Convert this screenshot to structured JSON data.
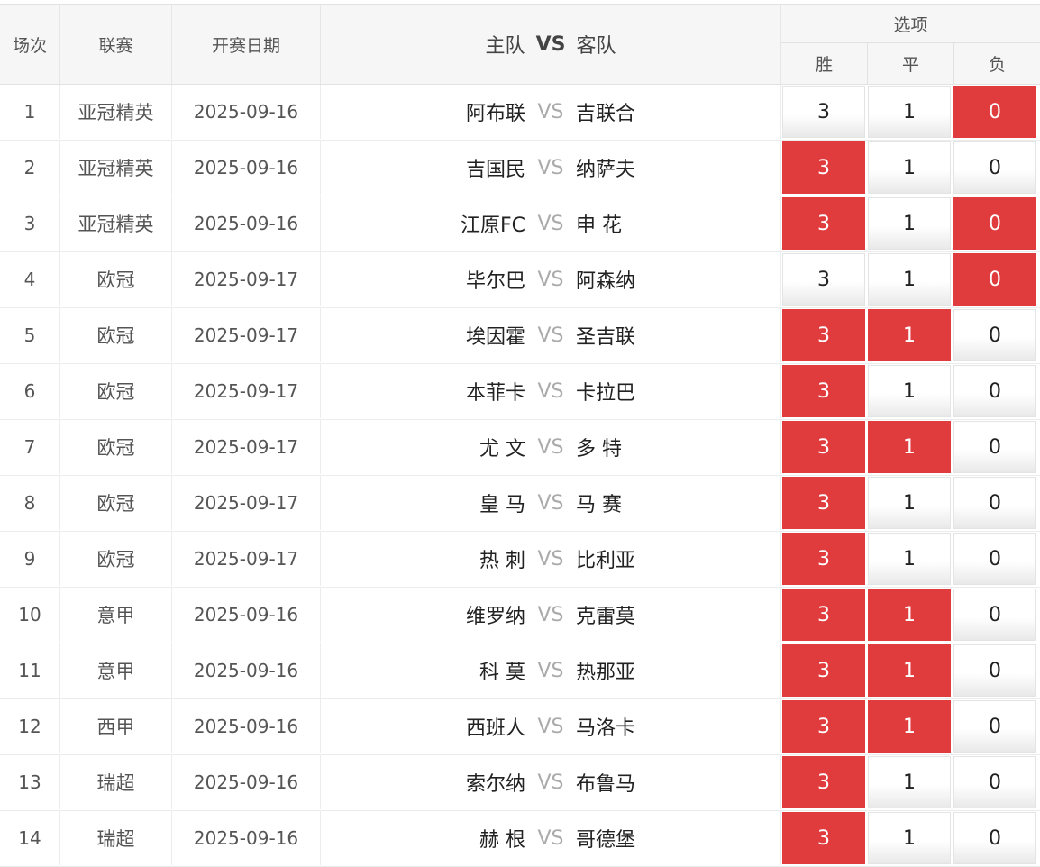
{
  "header": {
    "no": "场次",
    "league": "联赛",
    "date": "开赛日期",
    "home": "主队",
    "vs": "VS",
    "away": "客队",
    "options": "选项",
    "win": "胜",
    "draw": "平",
    "lose": "负"
  },
  "colors": {
    "selected": "#e03c3e",
    "vs_text": "#aaaaaa"
  },
  "rows": [
    {
      "no": "1",
      "league": "亚冠精英",
      "date": "2025-09-16",
      "home": "阿布联",
      "vs": "VS",
      "away": "吉联合",
      "w": "3",
      "d": "1",
      "l": "0",
      "sel": [
        false,
        false,
        true
      ]
    },
    {
      "no": "2",
      "league": "亚冠精英",
      "date": "2025-09-16",
      "home": "吉国民",
      "vs": "VS",
      "away": "纳萨夫",
      "w": "3",
      "d": "1",
      "l": "0",
      "sel": [
        true,
        false,
        false
      ]
    },
    {
      "no": "3",
      "league": "亚冠精英",
      "date": "2025-09-16",
      "home": "江原FC",
      "vs": "VS",
      "away": "申 花",
      "w": "3",
      "d": "1",
      "l": "0",
      "sel": [
        true,
        false,
        true
      ]
    },
    {
      "no": "4",
      "league": "欧冠",
      "date": "2025-09-17",
      "home": "毕尔巴",
      "vs": "VS",
      "away": "阿森纳",
      "w": "3",
      "d": "1",
      "l": "0",
      "sel": [
        false,
        false,
        true
      ]
    },
    {
      "no": "5",
      "league": "欧冠",
      "date": "2025-09-17",
      "home": "埃因霍",
      "vs": "VS",
      "away": "圣吉联",
      "w": "3",
      "d": "1",
      "l": "0",
      "sel": [
        true,
        true,
        false
      ]
    },
    {
      "no": "6",
      "league": "欧冠",
      "date": "2025-09-17",
      "home": "本菲卡",
      "vs": "VS",
      "away": "卡拉巴",
      "w": "3",
      "d": "1",
      "l": "0",
      "sel": [
        true,
        false,
        false
      ]
    },
    {
      "no": "7",
      "league": "欧冠",
      "date": "2025-09-17",
      "home": "尤 文",
      "vs": "VS",
      "away": "多 特",
      "w": "3",
      "d": "1",
      "l": "0",
      "sel": [
        true,
        true,
        false
      ]
    },
    {
      "no": "8",
      "league": "欧冠",
      "date": "2025-09-17",
      "home": "皇 马",
      "vs": "VS",
      "away": "马 赛",
      "w": "3",
      "d": "1",
      "l": "0",
      "sel": [
        true,
        false,
        false
      ]
    },
    {
      "no": "9",
      "league": "欧冠",
      "date": "2025-09-17",
      "home": "热 刺",
      "vs": "VS",
      "away": "比利亚",
      "w": "3",
      "d": "1",
      "l": "0",
      "sel": [
        true,
        false,
        false
      ]
    },
    {
      "no": "10",
      "league": "意甲",
      "date": "2025-09-16",
      "home": "维罗纳",
      "vs": "VS",
      "away": "克雷莫",
      "w": "3",
      "d": "1",
      "l": "0",
      "sel": [
        true,
        true,
        false
      ]
    },
    {
      "no": "11",
      "league": "意甲",
      "date": "2025-09-16",
      "home": "科 莫",
      "vs": "VS",
      "away": "热那亚",
      "w": "3",
      "d": "1",
      "l": "0",
      "sel": [
        true,
        true,
        false
      ]
    },
    {
      "no": "12",
      "league": "西甲",
      "date": "2025-09-16",
      "home": "西班人",
      "vs": "VS",
      "away": "马洛卡",
      "w": "3",
      "d": "1",
      "l": "0",
      "sel": [
        true,
        true,
        false
      ]
    },
    {
      "no": "13",
      "league": "瑞超",
      "date": "2025-09-16",
      "home": "索尔纳",
      "vs": "VS",
      "away": "布鲁马",
      "w": "3",
      "d": "1",
      "l": "0",
      "sel": [
        true,
        false,
        false
      ]
    },
    {
      "no": "14",
      "league": "瑞超",
      "date": "2025-09-16",
      "home": "赫 根",
      "vs": "VS",
      "away": "哥德堡",
      "w": "3",
      "d": "1",
      "l": "0",
      "sel": [
        true,
        false,
        false
      ]
    }
  ]
}
